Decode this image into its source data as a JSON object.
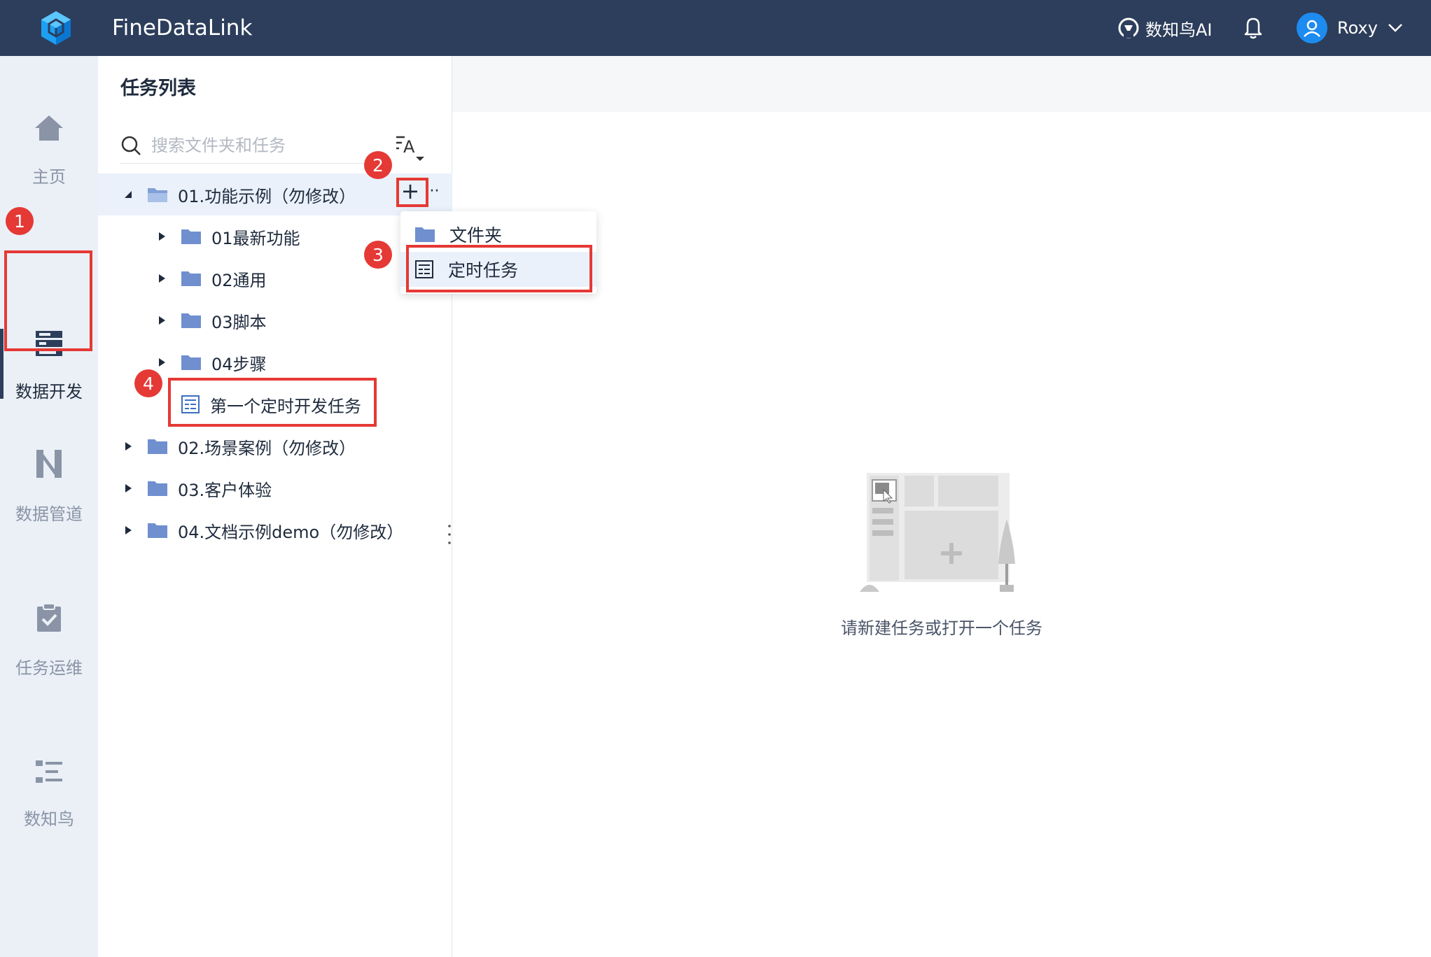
{
  "app": {
    "title": "FineDataLink"
  },
  "header": {
    "ai_label": "数知鸟AI",
    "user_name": "Roxy",
    "colors": {
      "bar": "#2c3e5b",
      "avatar": "#1e8bf0"
    }
  },
  "leftnav": {
    "items": [
      {
        "label": "主页",
        "icon": "home-icon"
      },
      {
        "label": "数据开发",
        "icon": "data-dev-icon",
        "active": true
      },
      {
        "label": "数据管道",
        "icon": "pipeline-icon"
      },
      {
        "label": "任务运维",
        "icon": "task-ops-icon"
      },
      {
        "label": "数知鸟",
        "icon": "list-icon"
      }
    ]
  },
  "panel": {
    "title": "任务列表",
    "search_placeholder": "搜索文件夹和任务",
    "tree": [
      {
        "label": "01.功能示例（勿修改）",
        "type": "folder",
        "expanded": true
      },
      {
        "label": "01最新功能",
        "type": "folder"
      },
      {
        "label": "02通用",
        "type": "folder"
      },
      {
        "label": "03脚本",
        "type": "folder"
      },
      {
        "label": "04步骤",
        "type": "folder"
      },
      {
        "label": "第一个定时开发任务",
        "type": "task"
      },
      {
        "label": "02.场景案例（勿修改）",
        "type": "folder"
      },
      {
        "label": "03.客户体验",
        "type": "folder"
      },
      {
        "label": "04.文档示例demo（勿修改）",
        "type": "folder"
      }
    ],
    "add_symbol": "+",
    "more_symbol": "···"
  },
  "menu": {
    "items": [
      {
        "label": "文件夹",
        "icon": "folder-icon"
      },
      {
        "label": "定时任务",
        "icon": "scheduled-task-icon"
      }
    ]
  },
  "content": {
    "empty_text": "请新建任务或打开一个任务"
  },
  "annotations": {
    "badges": [
      "1",
      "2",
      "3",
      "4"
    ],
    "color": "#e53935"
  }
}
